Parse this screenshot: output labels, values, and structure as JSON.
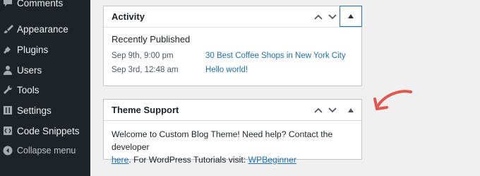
{
  "sidebar": {
    "items": [
      {
        "label": "Comments",
        "icon": "comment-icon"
      },
      {
        "label": "Appearance",
        "icon": "paintbrush-icon"
      },
      {
        "label": "Plugins",
        "icon": "plugin-icon"
      },
      {
        "label": "Users",
        "icon": "user-icon"
      },
      {
        "label": "Tools",
        "icon": "wrench-icon"
      },
      {
        "label": "Settings",
        "icon": "sliders-icon"
      },
      {
        "label": "Code Snippets",
        "icon": "code-icon"
      }
    ],
    "collapse": {
      "label": "Collapse menu",
      "icon": "collapse-icon"
    }
  },
  "activity": {
    "title": "Activity",
    "section_title": "Recently Published",
    "posts": [
      {
        "date": "Sep 9th, 9:00 pm",
        "title": "30 Best Coffee Shops in New York City"
      },
      {
        "date": "Sep 3rd, 12:48 am",
        "title": "Hello world!"
      }
    ]
  },
  "theme_support": {
    "title": "Theme Support",
    "text_1": "Welcome to Custom Blog Theme! Need help? Contact the developer",
    "link_here": "here",
    "text_2": ". For WordPress Tutorials visit: ",
    "link_wpb": "WPBeginner"
  },
  "colors": {
    "sidebar_bg": "#1d2327",
    "link": "#2271b1",
    "arrow": "#e2574c",
    "page_bg": "#f0f0f1"
  }
}
